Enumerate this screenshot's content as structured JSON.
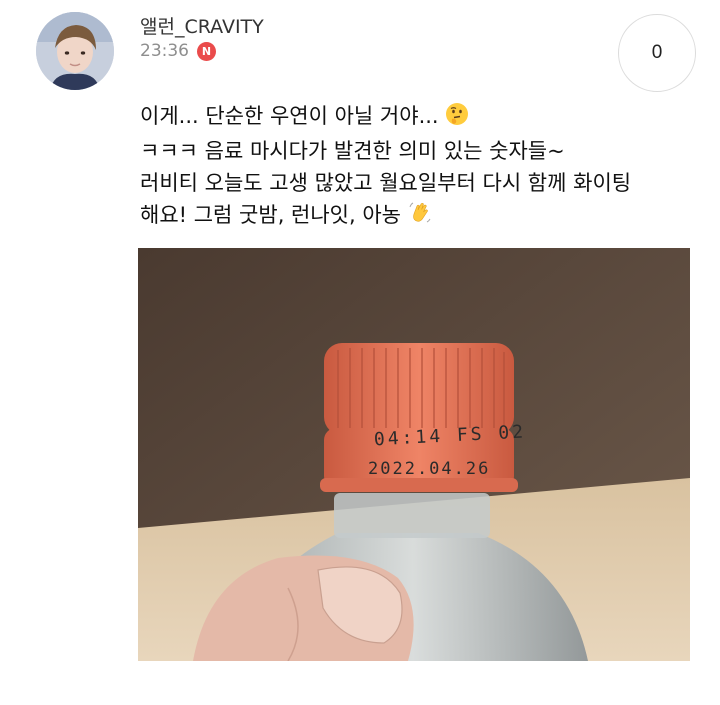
{
  "post": {
    "author": "앨런_CRAVITY",
    "time": "23:36",
    "badge": "N",
    "count": "0",
    "lines": [
      "이게... 단순한 우연이 아닐 거야...",
      "ㅋㅋㅋ 음료 마시다가 발견한 의미 있는 숫자들~",
      "러비티 오늘도 고생 많았고 월요일부터 다시 함께 화이팅",
      "해요! 그럼 굿밤, 런나잇, 아농"
    ],
    "emoji_line1": "thinking-face",
    "emoji_line4": "waving-hand"
  },
  "photo": {
    "cap_print_top": "04:14 FS 02",
    "cap_print_date": "2022.04.26",
    "cap_color": "#e4765a"
  }
}
